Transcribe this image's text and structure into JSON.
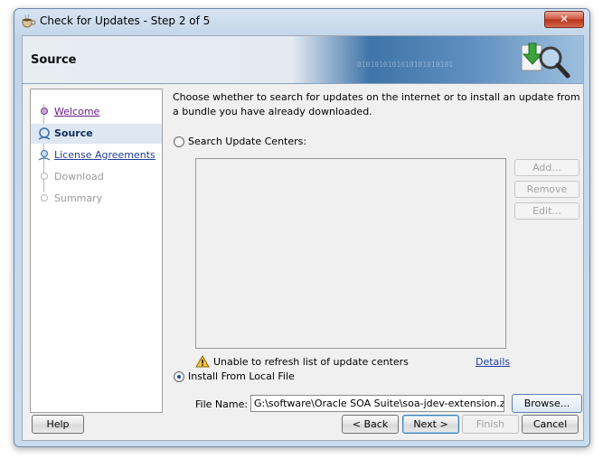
{
  "window": {
    "title": "Check for Updates - Step 2 of 5",
    "close_glyph": "✕"
  },
  "header": {
    "title": "Source",
    "binary_pattern": "0101010101010101010101"
  },
  "steps": [
    {
      "label": "Welcome",
      "state": "visited"
    },
    {
      "label": "Source",
      "state": "current"
    },
    {
      "label": "License Agreements",
      "state": "link"
    },
    {
      "label": "Download",
      "state": "disabled"
    },
    {
      "label": "Summary",
      "state": "disabled"
    }
  ],
  "content": {
    "description": "Choose whether to search for updates on the internet or to install an update from a bundle you have already downloaded.",
    "search_option": {
      "label": "Search Update Centers:",
      "selected": false
    },
    "side_buttons": {
      "add": "Add...",
      "remove": "Remove",
      "edit": "Edit..."
    },
    "warning": {
      "text": "Unable to refresh list of update centers",
      "details_link": "Details"
    },
    "local_option": {
      "label": "Install From Local File",
      "selected": true
    },
    "file_name": {
      "label": "File Name:",
      "value": "G:\\software\\Oracle SOA Suite\\soa-jdev-extension.zip"
    },
    "browse": "Browse..."
  },
  "footer": {
    "help": "Help",
    "back": "< Back",
    "next": "Next >",
    "finish": "Finish",
    "cancel": "Cancel"
  },
  "colors": {
    "link": "#1f3e99",
    "visited": "#6a1b86",
    "disabled": "#a3a3a3"
  }
}
